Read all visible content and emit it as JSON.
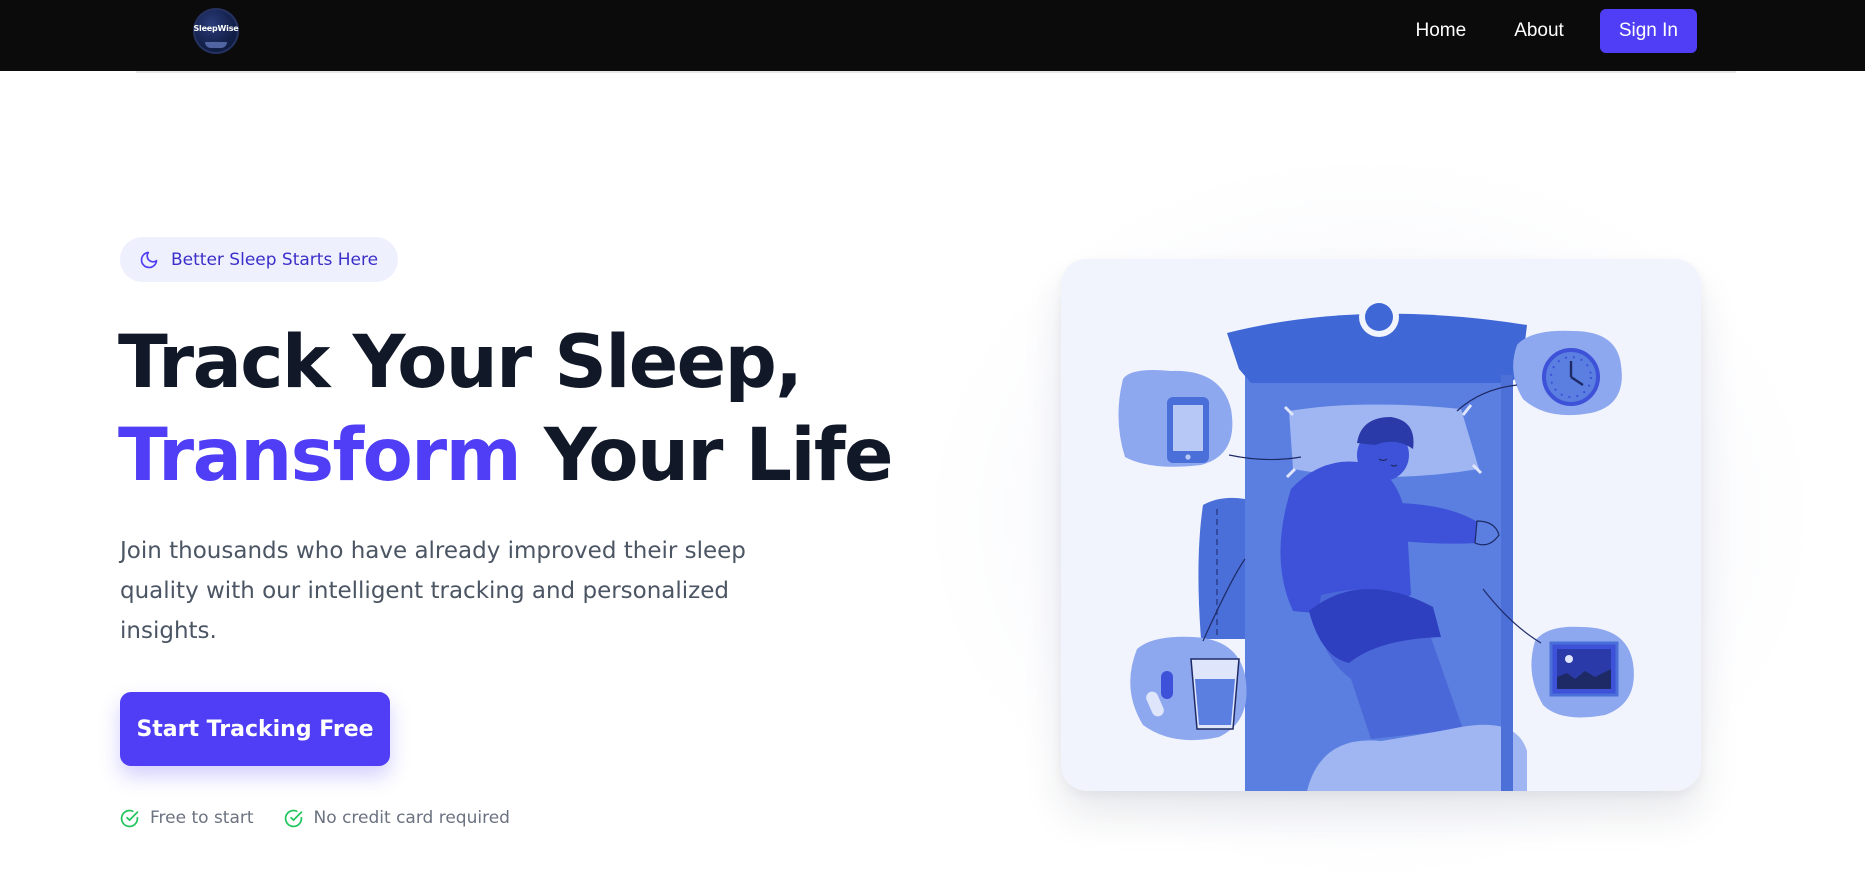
{
  "nav": {
    "logo_text": "SleepWise",
    "links": [
      {
        "label": "Home"
      },
      {
        "label": "About"
      }
    ],
    "signin_label": "Sign In",
    "signin_color": "#4f3ef5"
  },
  "hero": {
    "badge": {
      "icon": "moon-icon",
      "label": "Better Sleep Starts Here"
    },
    "headline": {
      "line1": "Track Your Sleep,",
      "accent": "Transform",
      "line2_rest": " Your Life"
    },
    "subtext": "Join thousands who have already improved their sleep quality with our intelligent tracking and personalized insights.",
    "cta_label": "Start Tracking Free",
    "perks": [
      {
        "icon": "check-circle-icon",
        "label": "Free to start"
      },
      {
        "icon": "check-circle-icon",
        "label": "No credit card required"
      }
    ],
    "illustration": {
      "subject": "sleeping-person-illustration",
      "items": [
        "phone-icon",
        "clock-icon",
        "water-glass-icon",
        "pills-icon",
        "night-window-icon"
      ]
    }
  },
  "colors": {
    "accent": "#4f3ef5",
    "nav_bg": "#0b0b0c",
    "headline": "#111827",
    "check": "#22c55e",
    "illustration_blue": "#5b7fe0"
  }
}
